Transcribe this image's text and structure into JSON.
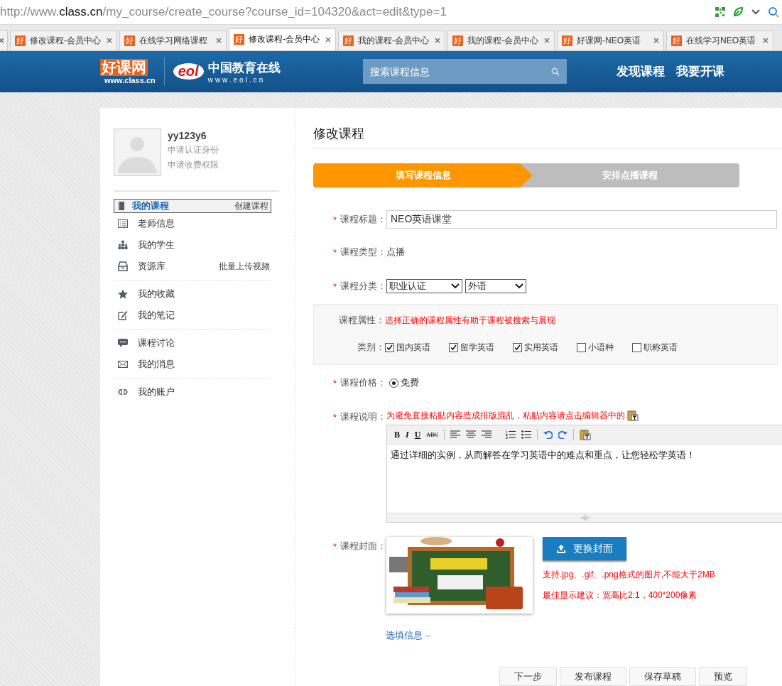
{
  "browser": {
    "url_prefix": "http://www.",
    "url_domain": "class.cn",
    "url_path": "/my_course/create_course?course_id=104320&act=edit&type=1"
  },
  "tabs": [
    {
      "icon": "好",
      "title": "修改课程-会员中心",
      "selected": false
    },
    {
      "icon": "好",
      "title": "在线学习网络课程",
      "selected": false
    },
    {
      "icon": "好",
      "title": "修改课程-会员中心",
      "selected": true
    },
    {
      "icon": "好",
      "title": "我的课程-会员中心",
      "selected": false
    },
    {
      "icon": "好",
      "title": "我的课程-会员中心",
      "selected": false
    },
    {
      "icon": "好",
      "title": "好课网-NEO英语",
      "selected": false
    },
    {
      "icon": "好",
      "title": "在线学习NEO英语",
      "selected": false
    }
  ],
  "header": {
    "logo": {
      "name": "好课网",
      "url": "www.class.cn"
    },
    "partner": {
      "mark": "eol",
      "name": "中国教育在线",
      "url": "www.eol.cn"
    },
    "search": {
      "placeholder": "搜索课程信息"
    },
    "nav": [
      "发现课程",
      "我要开课"
    ]
  },
  "sidebar": {
    "user": {
      "name": "yy123y6",
      "links": [
        "申请认证身份",
        "申请收费权限"
      ]
    },
    "groups": [
      {
        "items": [
          {
            "kind": "book",
            "label": "我的课程",
            "action": "创建课程",
            "selected": true
          },
          {
            "kind": "list",
            "label": "老师信息",
            "selected": false
          },
          {
            "kind": "people",
            "label": "我的学生",
            "selected": false
          },
          {
            "kind": "drawer",
            "label": "资源库",
            "action": "批量上传视频",
            "selected": false
          }
        ]
      },
      {
        "items": [
          {
            "kind": "star",
            "label": "我的收藏",
            "selected": false
          },
          {
            "kind": "edit",
            "label": "我的笔记",
            "selected": false
          }
        ]
      },
      {
        "items": [
          {
            "kind": "chat",
            "label": "课程讨论",
            "selected": false
          },
          {
            "kind": "mail",
            "label": "我的消息",
            "selected": false
          }
        ]
      },
      {
        "items": [
          {
            "kind": "link",
            "label": "我的账户",
            "selected": false
          }
        ]
      }
    ]
  },
  "main": {
    "title": "修改课程",
    "steps": [
      {
        "label": "填写课程信息",
        "selected": true
      },
      {
        "label": "安排点播课程",
        "selected": false
      }
    ],
    "fields": [
      {
        "kind": "text",
        "required_mark": "*",
        "label": "课程标题：",
        "value": "NEO英语课堂"
      },
      {
        "kind": "static",
        "required_mark": "*",
        "label": "课程类型：",
        "value": "点播"
      },
      {
        "kind": "selects",
        "required_mark": "*",
        "label": "课程分类：",
        "values": [
          "职业认证",
          "外语"
        ]
      },
      {
        "kind": "attributes",
        "label": "课程属性：",
        "hint": "选择正确的课程属性有助于课程被搜索与展现",
        "category_label": "类别：",
        "options": [
          {
            "label": "国内英语",
            "checked": true
          },
          {
            "label": "留学英语",
            "checked": true
          },
          {
            "label": "实用英语",
            "checked": true
          },
          {
            "label": "小语种",
            "checked": false
          },
          {
            "label": "职称英语",
            "checked": false
          }
        ]
      },
      {
        "kind": "radio",
        "required_mark": "*",
        "label": "课程价格：",
        "options": [
          {
            "label": "免费",
            "selected": true
          }
        ]
      },
      {
        "kind": "editor",
        "required_mark": "*",
        "label": "课程说明：",
        "hint": "为避免直接粘贴内容造成排版混乱，粘贴内容请点击编辑器中的",
        "value": "通过详细的实例，从而解答在学习英语中的难点和重点，让您轻松学英语！",
        "toolbar": [
          {
            "kind": "bold",
            "label": "B"
          },
          {
            "kind": "italic",
            "label": "I"
          },
          {
            "kind": "underline",
            "label": "U"
          },
          {
            "kind": "strike",
            "label": "ABC"
          },
          {
            "kind": "separator"
          },
          {
            "kind": "align-left"
          },
          {
            "kind": "align-center"
          },
          {
            "kind": "align-right"
          },
          {
            "kind": "gap"
          },
          {
            "kind": "ordered-list"
          },
          {
            "kind": "bullet-list"
          },
          {
            "kind": "separator"
          },
          {
            "kind": "undo"
          },
          {
            "kind": "redo"
          },
          {
            "kind": "separator"
          },
          {
            "kind": "paste"
          }
        ]
      },
      {
        "kind": "cover",
        "required_mark": "*",
        "label": "课程封面：",
        "button": "更换封面",
        "notes": [
          "支持.jpg、.gif、.png格式的图片,不能大于2MB",
          "最佳显示建议：宽高比2:1，400*200像素"
        ]
      }
    ],
    "optional_link": "选填信息",
    "buttons": [
      "下一步",
      "发布课程",
      "保存草稿",
      "预览"
    ]
  }
}
